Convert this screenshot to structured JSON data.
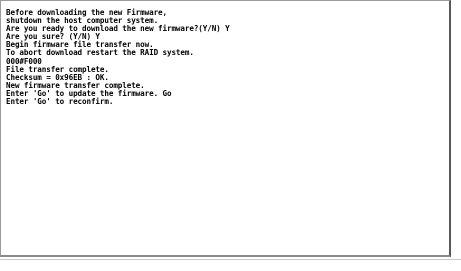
{
  "terminal": {
    "lines": [
      "Before downloading the new Firmware,",
      "shutdown the host computer system.",
      "Are you ready to download the new firmware?(Y/N) Y",
      "Are you sure? (Y/N) Y",
      "Begin firmware file transfer now.",
      "To abort download restart the RAID system.",
      "000#F000",
      "File transfer complete.",
      "Checksum = 0x96EB : OK.",
      "New firmware transfer complete.",
      "Enter 'Go' to update the firmware. Go",
      "Enter 'Go' to reconfirm."
    ]
  }
}
